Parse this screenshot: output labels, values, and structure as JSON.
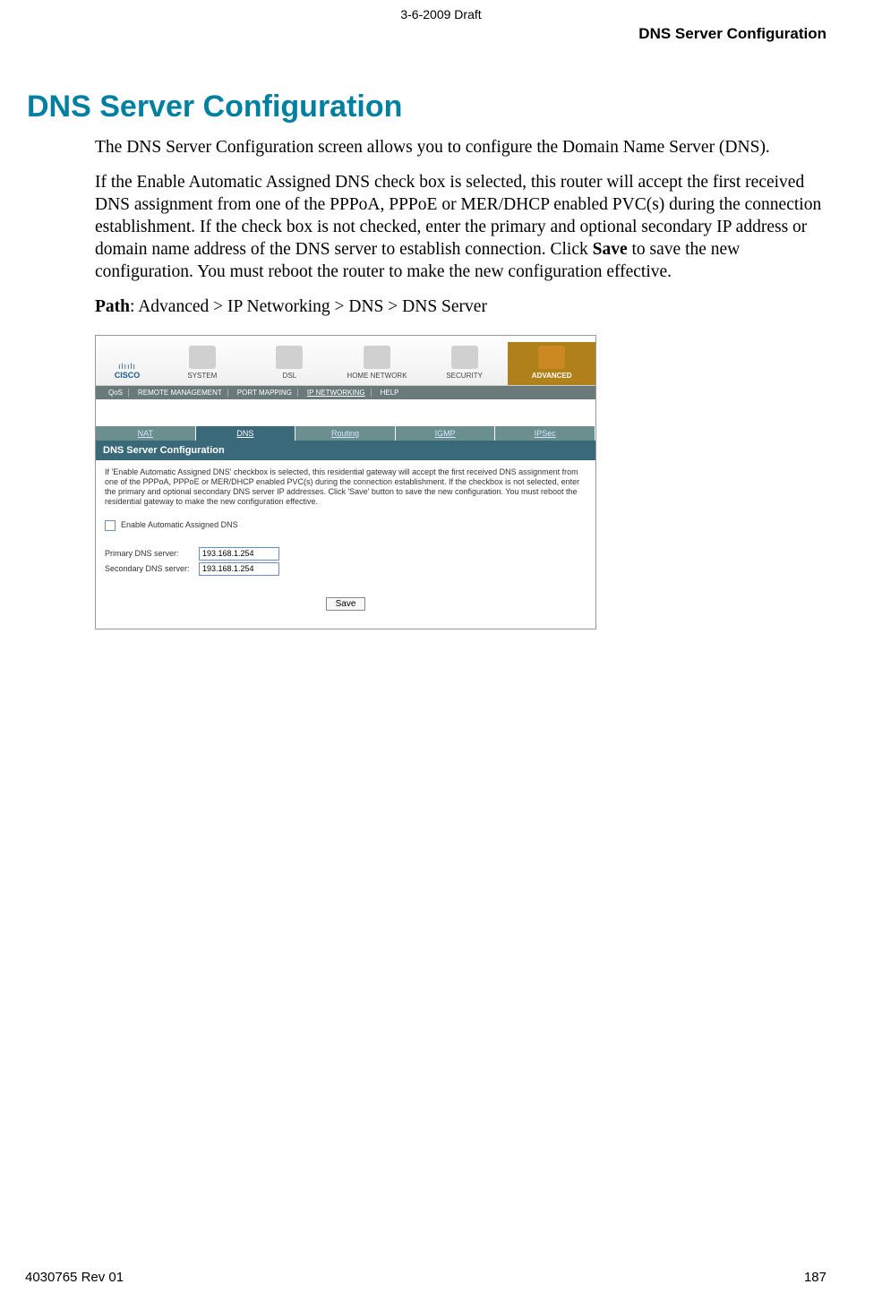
{
  "header": {
    "draft": "3-6-2009 Draft",
    "top_right": "DNS Server Configuration"
  },
  "page": {
    "title": "DNS Server Configuration",
    "para1": "The DNS Server Configuration screen allows you to configure the Domain Name Server (DNS).",
    "para2_a": "If the Enable Automatic Assigned DNS check box is selected, this router will accept the first received DNS assignment from one of the PPPoA, PPPoE or MER/DHCP enabled PVC(s) during the connection establishment. If the check box is not checked, enter the primary and optional secondary IP address or domain name address of the DNS server to establish connection.  Click ",
    "para2_save": "Save",
    "para2_b": " to save the new configuration. You must reboot the router to make the new configuration effective.",
    "path_label": "Path",
    "path_value": ":  Advanced > IP Networking > DNS > DNS Server"
  },
  "screenshot": {
    "logo_bars": "ılıılı",
    "logo_text": "CISCO",
    "nav": [
      "SYSTEM",
      "DSL",
      "HOME NETWORK",
      "SECURITY",
      "ADVANCED"
    ],
    "subnav": [
      "QoS",
      "REMOTE MANAGEMENT",
      "PORT MAPPING",
      "IP NETWORKING",
      "HELP"
    ],
    "tabs": [
      "NAT",
      "DNS",
      "Routing",
      "IGMP",
      "IPSec"
    ],
    "panel_title": "DNS Server Configuration",
    "panel_desc": "If 'Enable Automatic Assigned DNS' checkbox is selected, this residential gateway will accept the first received DNS assignment from one of the PPPoA, PPPoE or MER/DHCP enabled PVC(s) during the connection establishment. If the checkbox is not selected, enter the primary and optional secondary DNS server IP addresses. Click 'Save' button to save the new configuration. You must reboot the residential gateway to make the new configuration effective.",
    "chk_label": "Enable Automatic Assigned DNS",
    "primary_label": "Primary DNS server:",
    "secondary_label": "Secondary DNS server:",
    "primary_value": "193.168.1.254",
    "secondary_value": "193.168.1.254",
    "save_btn": "Save"
  },
  "footer": {
    "left": "4030765 Rev 01",
    "right": "187"
  }
}
